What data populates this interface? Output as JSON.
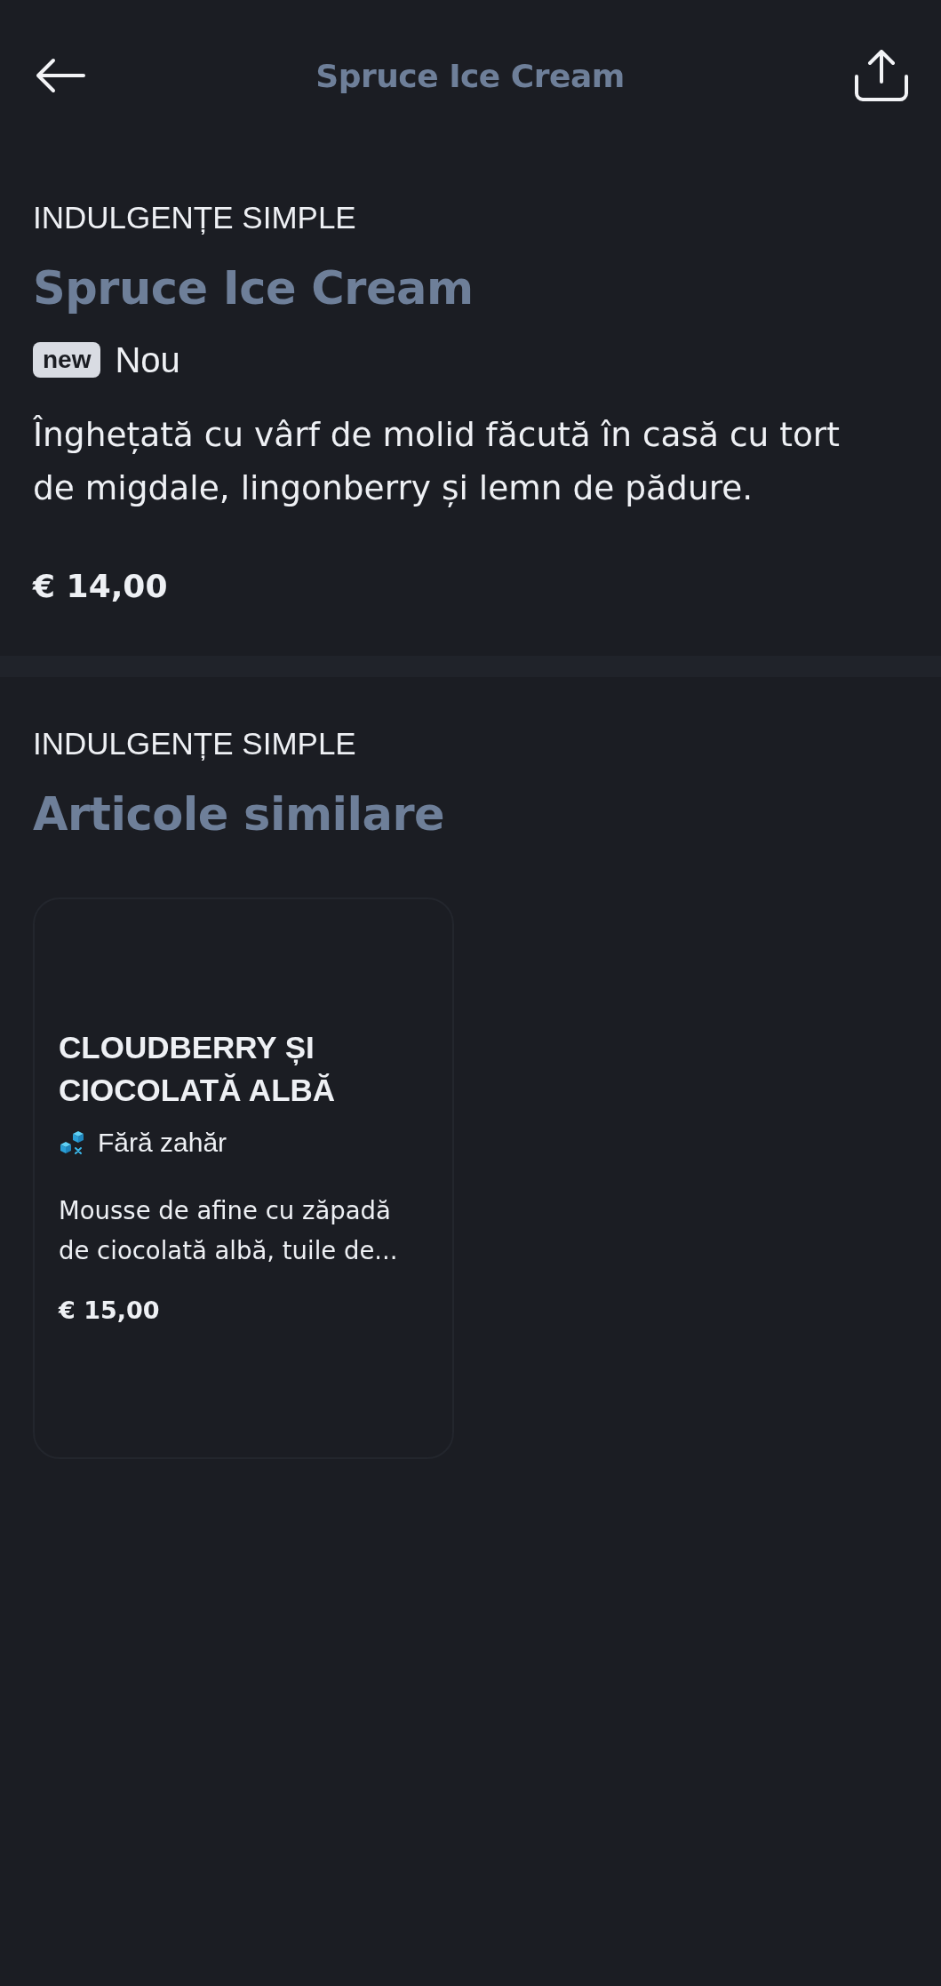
{
  "header": {
    "title": "Spruce Ice Cream"
  },
  "product": {
    "category": "INDULGENȚE SIMPLE",
    "name": "Spruce Ice Cream",
    "badges": [
      {
        "kind": "new",
        "tag": "new",
        "label": "Nou"
      }
    ],
    "description": "Înghețată cu vârf de molid făcută în casă cu tort de migdale, lingonberry și lemn de pădure.",
    "price": "€ 14,00"
  },
  "similar": {
    "category": "INDULGENȚE SIMPLE",
    "title": "Articole similare",
    "items": [
      {
        "name": "CLOUDBERRY ȘI CIOCOLATĂ ALBĂ",
        "tags": [
          {
            "kind": "sugar_free",
            "label": "Fără zahăr"
          }
        ],
        "description": "Mousse de afine cu zăpadă de ciocolată albă, tuile de...",
        "price": "€ 15,00"
      }
    ]
  }
}
